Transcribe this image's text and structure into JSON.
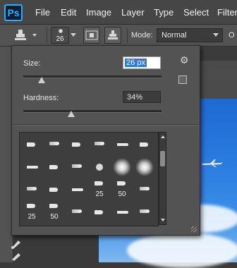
{
  "menubar": {
    "logo": "Ps",
    "items": [
      "File",
      "Edit",
      "Image",
      "Layer",
      "Type",
      "Select",
      "Filter"
    ]
  },
  "options_bar": {
    "brush_size_value": "26",
    "mode_label": "Mode:",
    "mode_value": "Normal",
    "opacity_label_partial": "O"
  },
  "brush_picker": {
    "size_label": "Size:",
    "size_value": "26 px",
    "size_slider_fraction": 0.12,
    "hardness_label": "Hardness:",
    "hardness_value": "34%",
    "hardness_slider_fraction": 0.34,
    "preset_numbers": [
      "25",
      "50",
      "25",
      "50"
    ]
  },
  "icons": {
    "logo": "photoshop-logo",
    "stamp": "clone-stamp-icon",
    "gear": "gear-icon",
    "new_preset": "new-preset-icon"
  },
  "colors": {
    "accent": "#31a8ff",
    "selection": "#3478d6",
    "panel": "#535353",
    "sky": "#2a7ce0"
  }
}
